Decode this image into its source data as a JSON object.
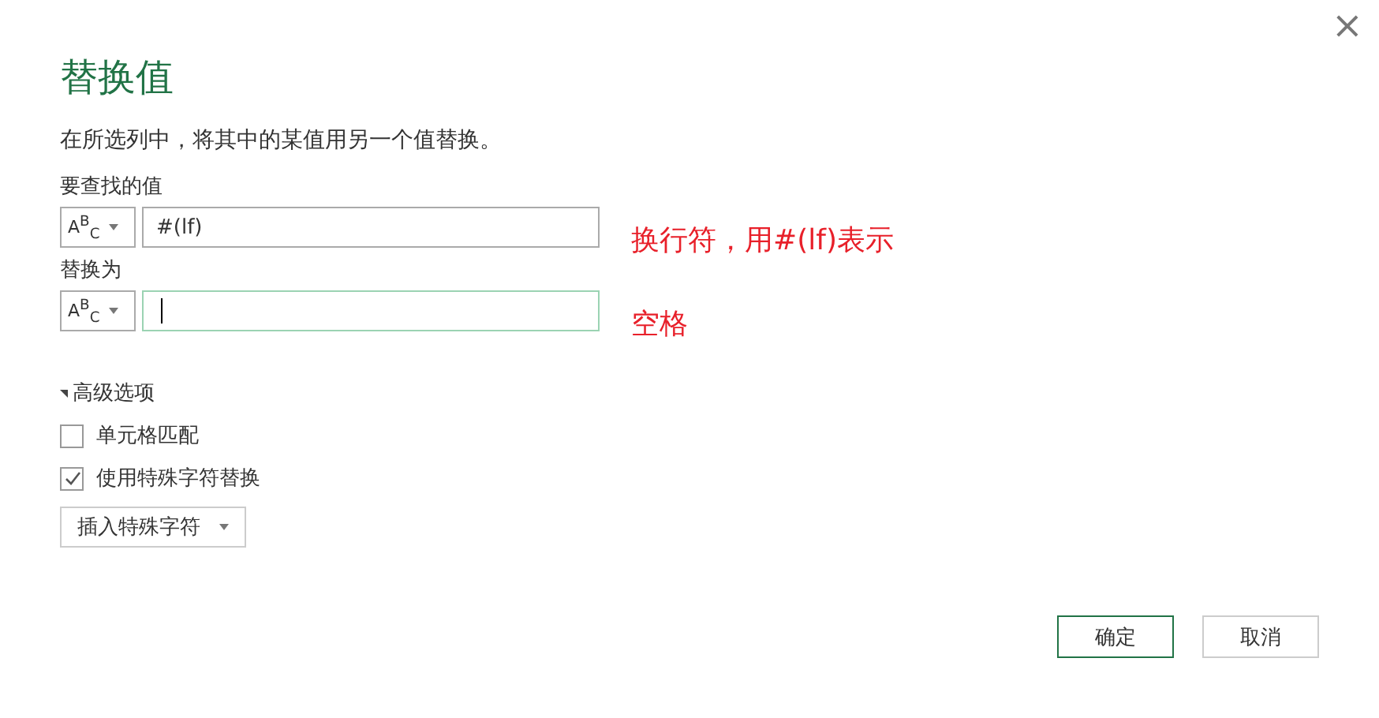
{
  "close_button": "×",
  "title": "替换值",
  "description": "在所选列中，将其中的某值用另一个值替换。",
  "fields": [
    {
      "label": "要查找的值",
      "type_label": "A$^{B}$$_{C}$",
      "value": "#(lf)",
      "focused": false,
      "annotation": "换行符，用#(lf)表示"
    },
    {
      "label": "替换为",
      "type_label": "A$^{B}$$_{C}$",
      "focused": true,
      "annotation": "空格"
    }
  ],
  "advanced": {
    "label": "高级选项",
    "expanded": true,
    "options": [
      {
        "label": "单元格匹配",
        "checked": false
      },
      {
        "label": "使用特殊字符替换",
        "checked": true
      }
    ],
    "insert_button": "插入特殊字符"
  },
  "buttons": [
    {
      "label": "确定",
      "primary": true
    },
    {
      "label": "取消",
      "primary": false
    }
  ]
}
